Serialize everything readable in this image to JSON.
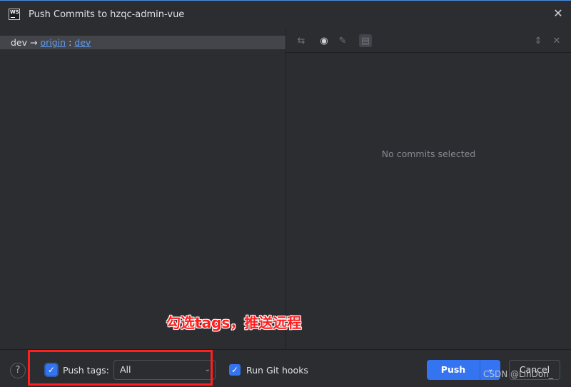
{
  "window": {
    "title": "Push Commits to hzqc-admin-vue",
    "logo_text": "WS"
  },
  "left": {
    "branch": {
      "local": "dev",
      "arrow": "→",
      "remote": "origin",
      "sep": ":",
      "remote_branch": "dev"
    }
  },
  "right": {
    "empty_message": "No commits selected"
  },
  "footer": {
    "help": "?",
    "push_tags_label": "Push tags:",
    "push_tags_checked": true,
    "push_tags_value": "All",
    "run_hooks_label": "Run Git hooks",
    "run_hooks_checked": true,
    "push_label": "Push",
    "cancel_label": "Cancel"
  },
  "annotation": {
    "text": "勾选tags，推送远程",
    "color": "#ff1f1f"
  },
  "watermark": "CSDN @LinDon_",
  "colors": {
    "accent": "#3574f0",
    "link": "#5e9cf2",
    "background": "#2b2d30"
  }
}
